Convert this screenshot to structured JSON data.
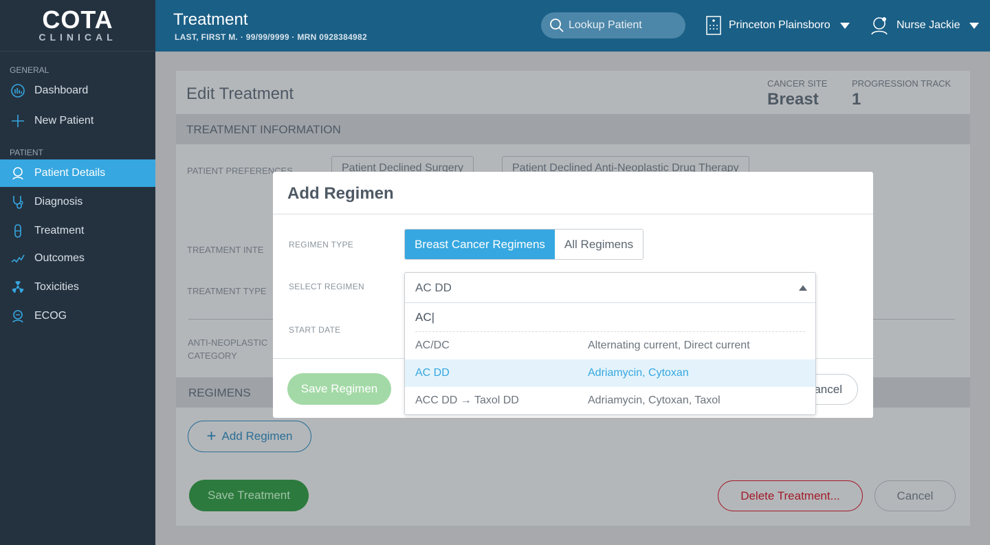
{
  "sidebar": {
    "logo_main": "COTA",
    "logo_sub": "CLINICAL",
    "sections": [
      {
        "label": "GENERAL"
      },
      {
        "label": "PATIENT"
      }
    ],
    "items": [
      {
        "label": "Dashboard",
        "icon": "chart-circle-icon"
      },
      {
        "label": "New Patient",
        "icon": "plus-icon"
      },
      {
        "label": "Patient Details",
        "icon": "person-icon",
        "active": true
      },
      {
        "label": "Diagnosis",
        "icon": "stethoscope-icon"
      },
      {
        "label": "Treatment",
        "icon": "pill-icon"
      },
      {
        "label": "Outcomes",
        "icon": "trend-line-icon"
      },
      {
        "label": "Toxicities",
        "icon": "radiation-icon"
      },
      {
        "label": "ECOG",
        "icon": "person-badge-icon"
      }
    ]
  },
  "header": {
    "title": "Treatment",
    "subtitle": "LAST, FIRST M. · 99/99/9999 · MRN 0928384982",
    "lookup_placeholder": "Lookup Patient",
    "hospital": "Princeton Plainsboro",
    "user": "Nurse Jackie"
  },
  "card": {
    "title": "Edit Treatment",
    "cancer_site_label": "CANCER SITE",
    "cancer_site": "Breast",
    "progression_label": "PROGRESSION TRACK",
    "progression": "1",
    "section_treatment": "TREATMENT INFORMATION",
    "patient_preferences_label": "PATIENT PREFERENCES",
    "pref_buttons": [
      "Patient Declined Surgery",
      "Patient Declined Anti-Neoplastic Drug Therapy"
    ],
    "treatment_intent_label": "TREATMENT INTE",
    "treatment_type_label": "TREATMENT TYPE",
    "anti_neoplastic_label_1": "ANTI-NEOPLASTIC",
    "anti_neoplastic_label_2": "CATEGORY",
    "section_regimens": "REGIMENS",
    "add_regimen": "Add Regimen",
    "save_treatment": "Save Treatment",
    "delete_treatment": "Delete Treatment...",
    "cancel": "Cancel"
  },
  "modal": {
    "title": "Add Regimen",
    "regimen_type_label": "REGIMEN TYPE",
    "regimen_types": [
      "Breast Cancer Regimens",
      "All Regimens"
    ],
    "selected_regimen_type": "Breast Cancer Regimens",
    "select_regimen_label": "SELECT REGIMEN",
    "start_date_label": "START DATE",
    "save_regimen": "Save Regimen",
    "cancel": "Cancel"
  },
  "dropdown": {
    "selected": "AC DD",
    "search_value": "AC|",
    "options": [
      {
        "name": "AC/DC",
        "desc": "Alternating current, Direct current"
      },
      {
        "name": "AC DD",
        "desc": "Adriamycin, Cytoxan",
        "highlighted": true
      },
      {
        "name": "ACC DD → Taxol DD",
        "desc": "Adriamycin, Cytoxan, Taxol"
      }
    ]
  },
  "colors": {
    "accent": "#36a7e0",
    "sidebar_bg": "#243240",
    "topbar_bg": "#1a5f86",
    "save_green": "#a3d9a6",
    "delete_red": "#a11a28"
  }
}
